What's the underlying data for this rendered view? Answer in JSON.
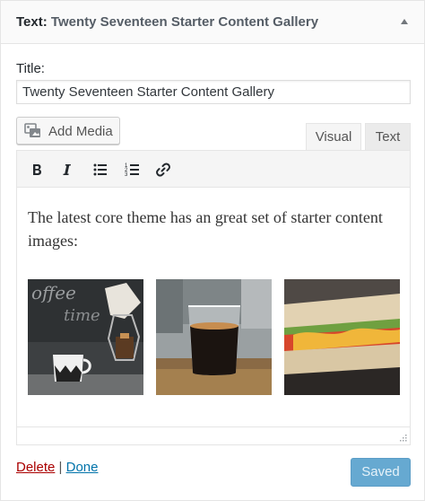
{
  "widget": {
    "type_label": "Text:",
    "in_title": "Twenty Seventeen Starter Content Gallery",
    "toggle_icon": "triangle-up-icon"
  },
  "form": {
    "title_label": "Title:",
    "title_value": "Twenty Seventeen Starter Content Gallery"
  },
  "editor": {
    "add_media_label": "Add Media",
    "tabs": [
      {
        "label": "Visual",
        "active": true
      },
      {
        "label": "Text",
        "active": false
      }
    ],
    "toolbar": [
      "bold-icon",
      "italic-icon",
      "bulleted-list-icon",
      "numbered-list-icon",
      "link-icon"
    ],
    "content_text": "The latest core theme has an great set of starter content images:",
    "gallery": [
      "coffee-chalkboard-image",
      "espresso-glass-image",
      "sandwich-image"
    ]
  },
  "actions": {
    "delete_label": "Delete",
    "separator": "|",
    "done_label": "Done",
    "saved_label": "Saved"
  },
  "colors": {
    "link": "#0073aa",
    "delete": "#aa0000",
    "primary_disabled": "#66a9d1"
  }
}
